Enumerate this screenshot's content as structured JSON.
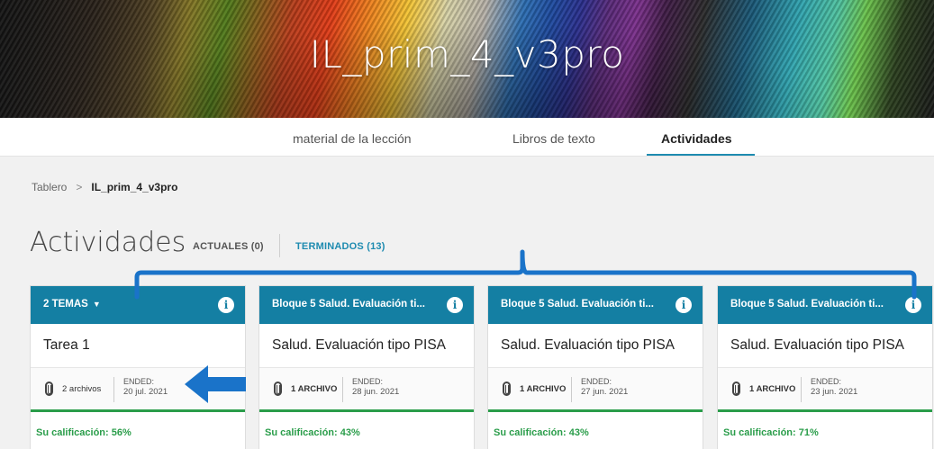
{
  "course": {
    "title": "IL_prim_4_v3pro"
  },
  "tabs": [
    {
      "label": "material de la lección",
      "active": false
    },
    {
      "label": "Libros de texto",
      "active": false
    },
    {
      "label": "Actividades",
      "active": true
    }
  ],
  "breadcrumb": {
    "root": "Tablero",
    "separator": ">",
    "current": "IL_prim_4_v3pro"
  },
  "section": {
    "title": "Actividades"
  },
  "filters": [
    {
      "label": "ACTUALES (0)",
      "active": false
    },
    {
      "label": "TERMINADOS (13)",
      "active": true
    }
  ],
  "cards": [
    {
      "header": "2 TEMAS",
      "header_caret": "▼",
      "title": "Tarea 1",
      "files": "2 archivos",
      "ended_label": "ENDED:",
      "ended_date": "20 jul. 2021",
      "grade": "Su calificación: 56%"
    },
    {
      "header": "Bloque 5 Salud. Evaluación ti...",
      "title": "Salud. Evaluación tipo PISA",
      "files": "1 ARCHIVO",
      "ended_label": "ENDED:",
      "ended_date": "28 jun. 2021",
      "grade": "Su calificación: 43%"
    },
    {
      "header": "Bloque 5 Salud. Evaluación ti...",
      "title": "Salud. Evaluación tipo PISA",
      "files": "1 ARCHIVO",
      "ended_label": "ENDED:",
      "ended_date": "27 jun. 2021",
      "grade": "Su calificación: 43%"
    },
    {
      "header": "Bloque 5 Salud. Evaluación ti...",
      "title": "Salud. Evaluación tipo PISA",
      "files": "1 ARCHIVO",
      "ended_label": "ENDED:",
      "ended_date": "23 jun. 2021",
      "grade": "Su calificación: 71%"
    }
  ],
  "icons": {
    "info": "info-icon",
    "attachment": "paperclip-icon",
    "dropdown": "chevron-down-icon"
  },
  "colors": {
    "accent": "#147fa3",
    "tab_underline": "#1e8bb0",
    "grade_green": "#2a9d4a",
    "annotation_blue": "#1a73c9"
  }
}
